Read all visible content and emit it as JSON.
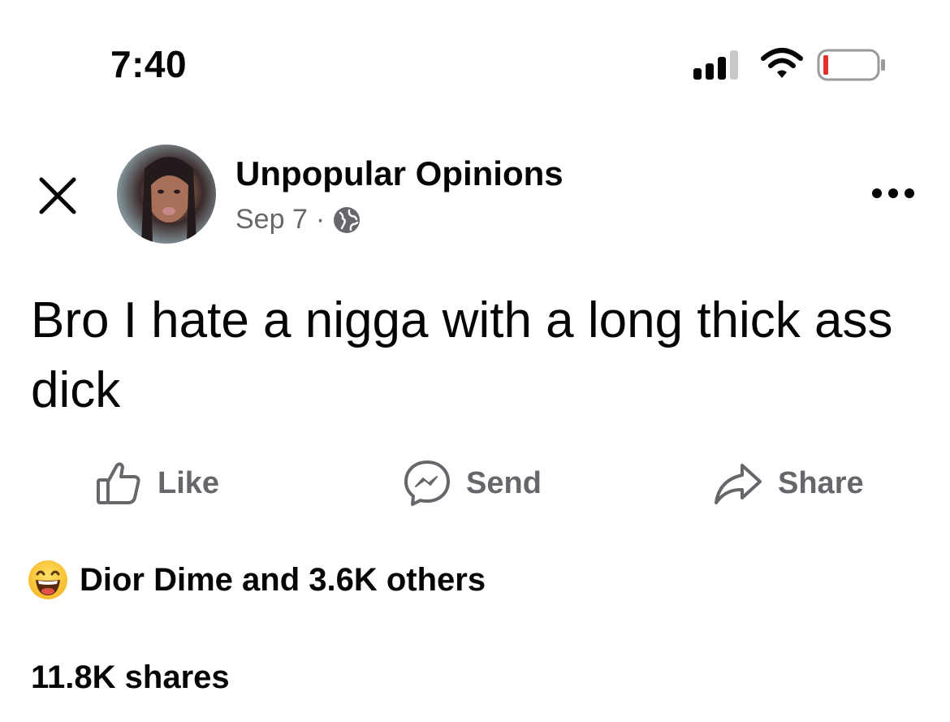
{
  "status_bar": {
    "time": "7:40",
    "icons": [
      "signal-icon",
      "wifi-icon",
      "battery-icon"
    ],
    "battery_color": "#e0322b"
  },
  "post": {
    "page_name": "Unpopular Opinions",
    "date": "Sep 7",
    "separator": "·",
    "privacy_icon": "globe-icon",
    "text": "Bro I hate a nigga with a long thick ass dick"
  },
  "actions": {
    "like_label": "Like",
    "send_label": "Send",
    "share_label": "Share"
  },
  "engagement": {
    "reaction_icon": "laughing-emoji-icon",
    "reactions_text": "Dior Dime and 3.6K others",
    "shares_text": "11.8K shares"
  },
  "colors": {
    "text_primary": "#050505",
    "text_secondary": "#65676b",
    "background": "#ffffff"
  }
}
